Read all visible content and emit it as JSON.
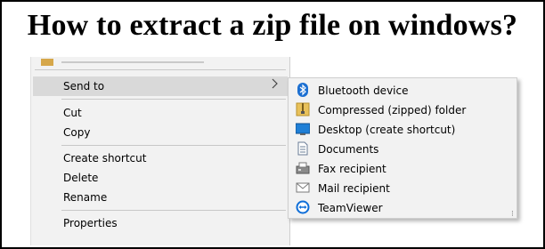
{
  "title": "How to extract a zip file on windows?",
  "context_menu": {
    "items": [
      {
        "label": "Send to",
        "icon": "chevron-right-icon",
        "highlighted": true
      },
      {
        "label": "Cut"
      },
      {
        "label": "Copy"
      },
      {
        "label": "Create shortcut"
      },
      {
        "label": "Delete"
      },
      {
        "label": "Rename"
      },
      {
        "label": "Properties"
      }
    ],
    "highlight_color": "#d9d9d9",
    "background_color": "#f2f2f2"
  },
  "send_to_menu": {
    "items": [
      {
        "label": "Bluetooth device",
        "icon": "bluetooth-icon"
      },
      {
        "label": "Compressed (zipped) folder",
        "icon": "zipped-folder-icon"
      },
      {
        "label": "Desktop (create shortcut)",
        "icon": "desktop-icon"
      },
      {
        "label": "Documents",
        "icon": "documents-icon"
      },
      {
        "label": "Fax recipient",
        "icon": "fax-icon"
      },
      {
        "label": "Mail recipient",
        "icon": "mail-icon"
      },
      {
        "label": "TeamViewer",
        "icon": "teamviewer-icon"
      }
    ]
  }
}
